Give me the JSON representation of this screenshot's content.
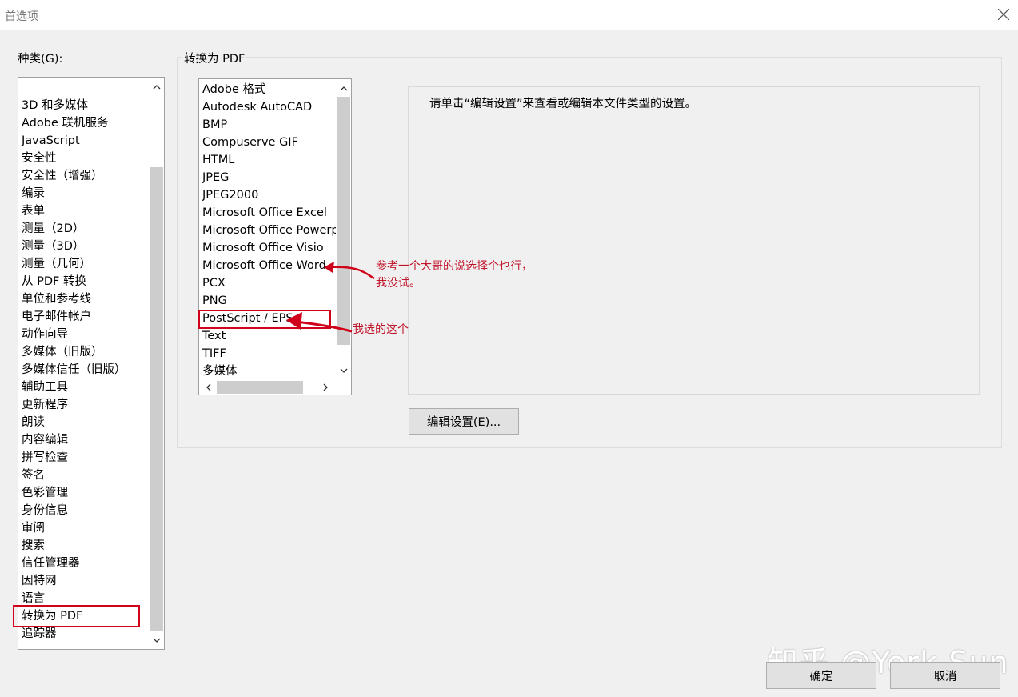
{
  "window": {
    "title": "首选项"
  },
  "category": {
    "label": "种类(G):",
    "items": [
      "3D 和多媒体",
      "Adobe 联机服务",
      "JavaScript",
      "安全性",
      "安全性（增强）",
      "编录",
      "表单",
      "测量（2D）",
      "测量（3D）",
      "测量（几何）",
      "从 PDF 转换",
      "单位和参考线",
      "电子邮件帐户",
      "动作向导",
      "多媒体（旧版）",
      "多媒体信任（旧版）",
      "辅助工具",
      "更新程序",
      "朗读",
      "内容编辑",
      "拼写检查",
      "签名",
      "色彩管理",
      "身份信息",
      "审阅",
      "搜索",
      "信任管理器",
      "因特网",
      "语言",
      "转换为 PDF",
      "追踪器"
    ],
    "selected": "转换为 PDF"
  },
  "convert": {
    "group_label": "转换为 PDF",
    "file_types": [
      "Adobe 格式",
      "Autodesk AutoCAD",
      "BMP",
      "Compuserve GIF",
      "HTML",
      "JPEG",
      "JPEG2000",
      "Microsoft Office Excel",
      "Microsoft Office Powerpoint",
      "Microsoft Office Visio",
      "Microsoft Office Word",
      "PCX",
      "PNG",
      "PostScript / EPS",
      "Text",
      "TIFF",
      "多媒体"
    ],
    "selected": "PostScript / EPS",
    "description": "请单击“编辑设置”来查看或编辑本文件类型的设置。",
    "edit_button": "编辑设置(E)..."
  },
  "annotations": {
    "note1": "参考一个大哥的说选择个也行，我没试。",
    "note2": "我选的这个",
    "color": "#d0021b"
  },
  "footer": {
    "ok": "确定",
    "cancel": "取消",
    "watermark": "知乎 @York Sun"
  }
}
